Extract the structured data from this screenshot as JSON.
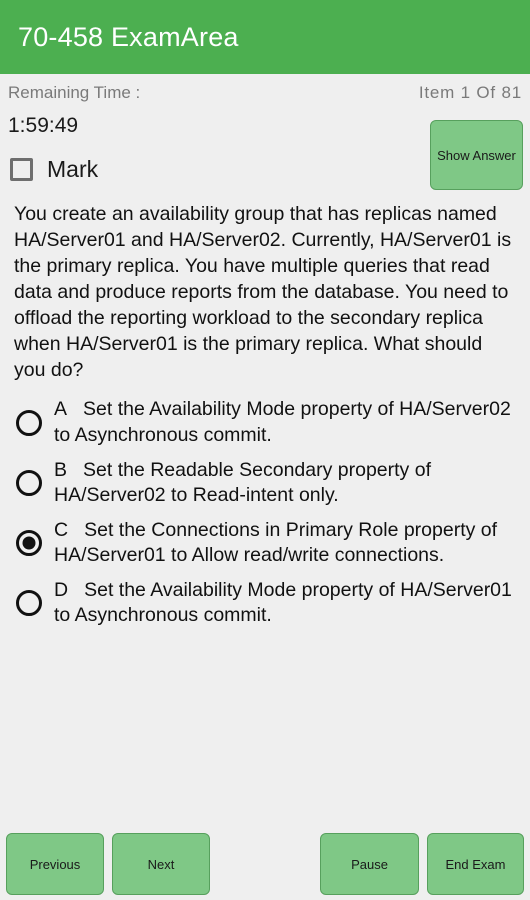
{
  "header": {
    "title": "70-458 ExamArea",
    "background_color": "#4caf50",
    "text_color": "#ffffff"
  },
  "status": {
    "remaining_time_label": "Remaining Time :",
    "item_counter": "Item  1  Of  81"
  },
  "timer": {
    "value": "1:59:49"
  },
  "mark": {
    "label": "Mark",
    "checked": false
  },
  "show_answer": {
    "label": "Show Answer"
  },
  "question": {
    "text": "You create an availability group that has replicas named HA/Server01 and HA/Server02. Currently, HA/Server01 is the primary replica. You have multiple queries that read data and produce reports from the database. You need to offload the reporting workload to the secondary replica when HA/Server01 is the primary replica. What should you do?"
  },
  "options": [
    {
      "letter": "A",
      "text": "Set the Availability Mode property of HA/Server02 to Asynchronous commit.",
      "selected": false
    },
    {
      "letter": "B",
      "text": "Set the Readable Secondary property of HA/Server02 to Read-intent only.",
      "selected": false
    },
    {
      "letter": "C",
      "text": "Set the Connections in Primary Role property of HA/Server01 to Allow read/write connections.",
      "selected": true
    },
    {
      "letter": "D",
      "text": "Set the Availability Mode property of HA/Server01 to Asynchronous commit.",
      "selected": false
    }
  ],
  "footer": {
    "previous_label": "Previous",
    "next_label": "Next",
    "pause_label": "Pause",
    "end_exam_label": "End Exam"
  },
  "colors": {
    "header_green": "#4caf50",
    "button_green": "#7fc886",
    "button_border": "#57a05d",
    "page_background": "#efefef",
    "muted_text": "#7a7a7a"
  }
}
